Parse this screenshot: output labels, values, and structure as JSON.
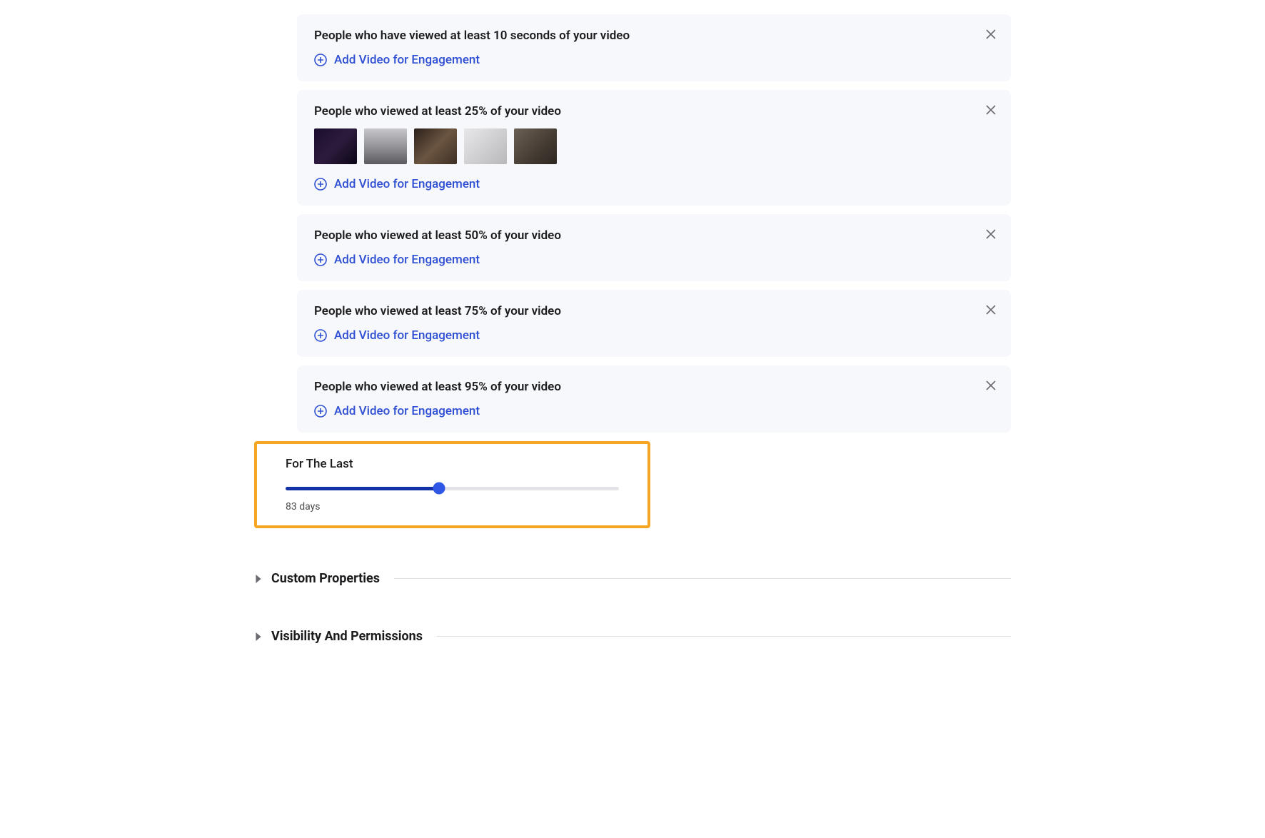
{
  "cards": [
    {
      "title": "People who have viewed at least 10 seconds of your video",
      "addLabel": "Add Video for Engagement",
      "thumbs": []
    },
    {
      "title": "People who viewed at least 25% of your video",
      "addLabel": "Add Video for Engagement",
      "thumbs": [
        "t1",
        "t2",
        "t3",
        "t4",
        "t5"
      ]
    },
    {
      "title": "People who viewed at least 50% of your video",
      "addLabel": "Add Video for Engagement",
      "thumbs": []
    },
    {
      "title": "People who viewed at least 75% of your video",
      "addLabel": "Add Video for Engagement",
      "thumbs": []
    },
    {
      "title": "People who viewed at least 95% of your video",
      "addLabel": "Add Video for Engagement",
      "thumbs": []
    }
  ],
  "slider": {
    "label": "For The Last",
    "valueText": "83 days",
    "percent": 46
  },
  "sections": [
    {
      "title": "Custom Properties"
    },
    {
      "title": "Visibility And Permissions"
    }
  ]
}
